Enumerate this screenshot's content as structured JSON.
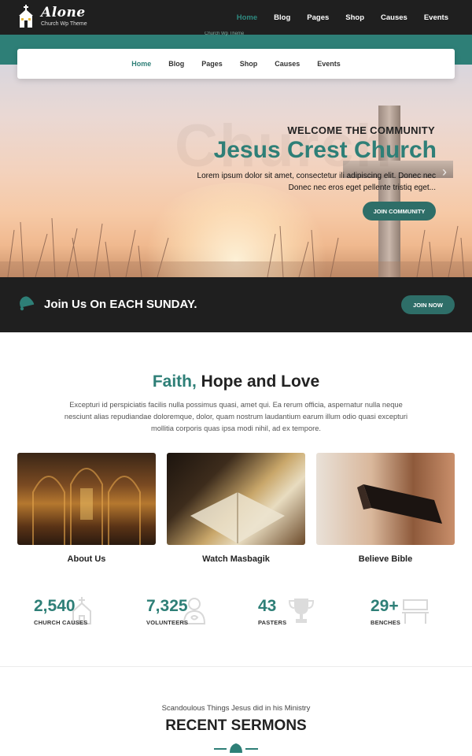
{
  "header": {
    "logo_name": "Alone",
    "logo_tagline": "Church Wp Theme",
    "nav": [
      "Home",
      "Blog",
      "Pages",
      "Shop",
      "Causes",
      "Events"
    ],
    "active_nav": "Home"
  },
  "sticky_nav": {
    "ghost_tagline": "Church Wp Theme",
    "items": [
      "Home",
      "Blog",
      "Pages",
      "Shop",
      "Causes",
      "Events"
    ]
  },
  "hero": {
    "kicker": "WELCOME THE COMMUNITY",
    "title": "Jesus Crest Church",
    "ghost_word": "Church",
    "description_line1": "Lorem ipsum dolor sit amet, consectetur ili adipiscing elit. Donec nec",
    "description_line2": "Donec nec eros eget pellente tristiq eget...",
    "button_label": "JOIN COMMUNITY",
    "next_arrow_icon": "chevron-right-icon"
  },
  "band": {
    "text": "Join Us On EACH SUNDAY.",
    "button_label": "JOIN NOW",
    "icon": "bell-icon"
  },
  "faith": {
    "title_accent": "Faith,",
    "title_rest": " Hope and Love",
    "description": "Excepturi id perspiciatis facilis nulla possimus quasi, amet qui. Ea rerum officia, aspernatur nulla neque nesciunt alias repudiandae doloremque, dolor, quam nostrum laudantium earum illum odio quasi excepturi mollitia corporis quas ipsa modi nihil, ad ex tempore."
  },
  "cards": [
    {
      "caption": "About Us",
      "image": "church-interior-image"
    },
    {
      "caption": "Watch Masbagik",
      "image": "open-bible-straw-image"
    },
    {
      "caption": "Believe Bible",
      "image": "holy-bible-stand-image"
    }
  ],
  "counters": [
    {
      "value": "2,540",
      "label": "CHURCH CAUSES",
      "icon": "church-icon"
    },
    {
      "value": "7,325",
      "label": "VOLUNTEERS",
      "icon": "volunteer-icon"
    },
    {
      "value": "43",
      "label": "PASTERS",
      "icon": "trophy-icon"
    },
    {
      "value": "29+",
      "label": "BENCHES",
      "icon": "bench-icon"
    }
  ],
  "sermons": {
    "kicker": "Scandoulous Things Jesus did in his Ministry",
    "title": "RECENT SERMONS"
  },
  "colors": {
    "accent": "#2e7f77",
    "dark": "#1f1f1f",
    "button": "#2e6e68"
  }
}
